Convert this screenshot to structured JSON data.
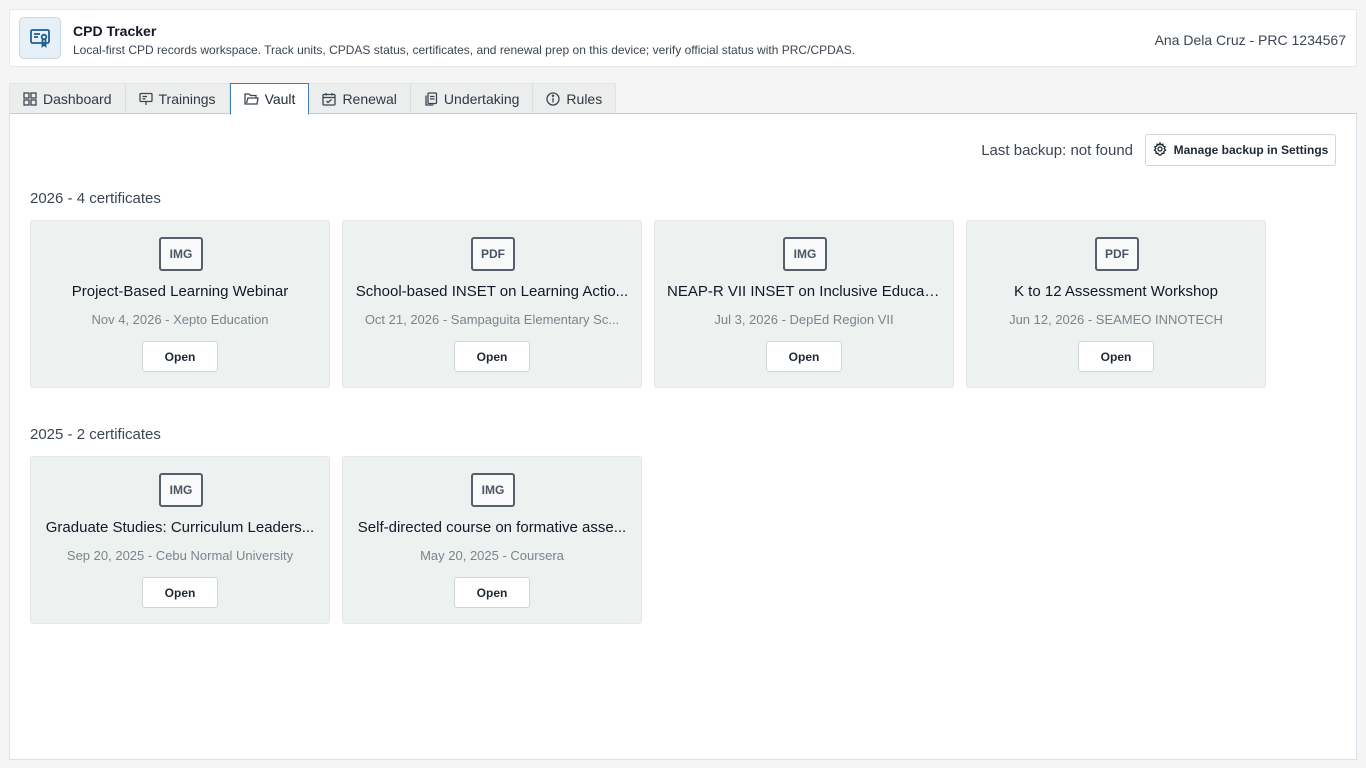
{
  "header": {
    "title": "CPD Tracker",
    "subtitle": "Local-first CPD records workspace. Track units, CPDAS status, certificates, and renewal prep on this device; verify official status with PRC/CPDAS.",
    "user": "Ana Dela Cruz - PRC 1234567",
    "icon": "certificate-icon"
  },
  "tabs": [
    {
      "label": "Dashboard",
      "icon": "grid-icon"
    },
    {
      "label": "Trainings",
      "icon": "presentation-icon"
    },
    {
      "label": "Vault",
      "icon": "folder-icon",
      "active": true
    },
    {
      "label": "Renewal",
      "icon": "calendar-icon"
    },
    {
      "label": "Undertaking",
      "icon": "documents-icon"
    },
    {
      "label": "Rules",
      "icon": "info-icon"
    }
  ],
  "backup": {
    "status": "Last backup: not found",
    "button_label": "Manage backup in Settings"
  },
  "sections": [
    {
      "title": "2026 - 4 certificates",
      "cards": [
        {
          "type": "IMG",
          "title": "Project-Based Learning Webinar",
          "meta": "Nov 4, 2026 - Xepto Education",
          "action": "Open"
        },
        {
          "type": "PDF",
          "title": "School-based INSET on Learning Actio...",
          "meta": "Oct 21, 2026 - Sampaguita Elementary Sc...",
          "action": "Open"
        },
        {
          "type": "IMG",
          "title": "NEAP-R VII INSET on Inclusive Educati...",
          "meta": "Jul 3, 2026 - DepEd Region VII",
          "action": "Open"
        },
        {
          "type": "PDF",
          "title": "K to 12 Assessment Workshop",
          "meta": "Jun 12, 2026 - SEAMEO INNOTECH",
          "action": "Open"
        }
      ]
    },
    {
      "title": "2025 - 2 certificates",
      "cards": [
        {
          "type": "IMG",
          "title": "Graduate Studies: Curriculum Leaders...",
          "meta": "Sep 20, 2025 - Cebu Normal University",
          "action": "Open"
        },
        {
          "type": "IMG",
          "title": "Self-directed course on formative asse...",
          "meta": "May 20, 2025 - Coursera",
          "action": "Open"
        }
      ]
    }
  ],
  "colors": {
    "accent": "#3f7fb5",
    "card_bg": "#edf2f1",
    "page_bg": "#f4f5f4"
  }
}
